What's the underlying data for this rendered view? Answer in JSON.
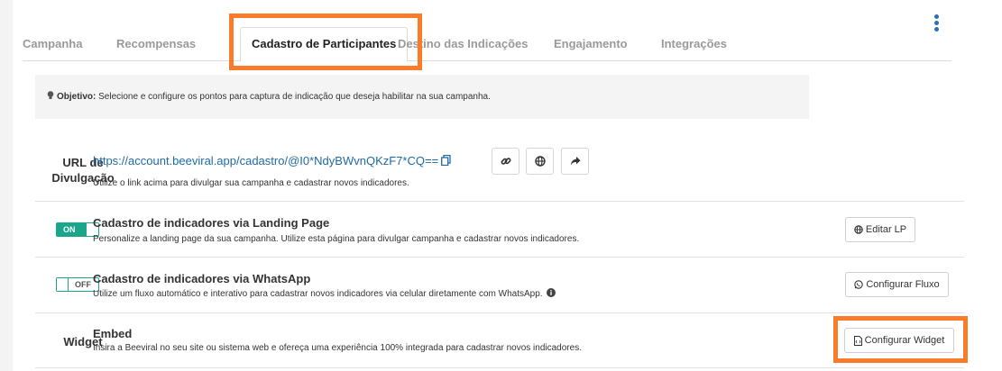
{
  "tabs": [
    {
      "label": "Campanha"
    },
    {
      "label": "Recompensas"
    },
    {
      "label": "Cadastro de Participantes"
    },
    {
      "label": "Destino das Indicações"
    },
    {
      "label": "Engajamento"
    },
    {
      "label": "Integrações"
    }
  ],
  "active_tab": "Cadastro de Participantes",
  "objective": {
    "label": "Objetivo:",
    "text": "Selecione e configure os pontos para captura de indicação que deseja habilitar na sua campanha."
  },
  "url_row": {
    "label_line1": "URL de",
    "label_line2": "Divulgação",
    "url": "https://account.beeviral.app/cadastro/@I0*NdyBWvnQKzF7*CQ==",
    "description": "Utilize o link acima para divulgar sua campanha e cadastrar novos indicadores.",
    "icons": [
      "copy-icon",
      "link-icon",
      "globe-icon",
      "share-icon"
    ]
  },
  "landing_row": {
    "toggle": "ON",
    "title": "Cadastro de indicadores via Landing Page",
    "description": "Personalize a landing page da sua campanha. Utilize esta página para divulgar campanha e cadastrar novos indicadores.",
    "button": "Editar LP"
  },
  "whatsapp_row": {
    "toggle": "OFF",
    "title": "Cadastro de indicadores via WhatsApp",
    "description": "Utilize um fluxo automático e interativo para cadastrar novos indicadores via celular diretamente com WhatsApp.",
    "button": "Configurar Fluxo"
  },
  "widget_row": {
    "label": "Widget",
    "title": "Embed",
    "description": "Insira a Beeviral no seu site ou sistema web e ofereça uma experiência 100% integrada para cadastrar novos indicadores.",
    "button": "Configurar Widget"
  },
  "colors": {
    "accent": "#19a68a",
    "link": "#1f6aa5",
    "highlight": "#fa7b2a"
  }
}
